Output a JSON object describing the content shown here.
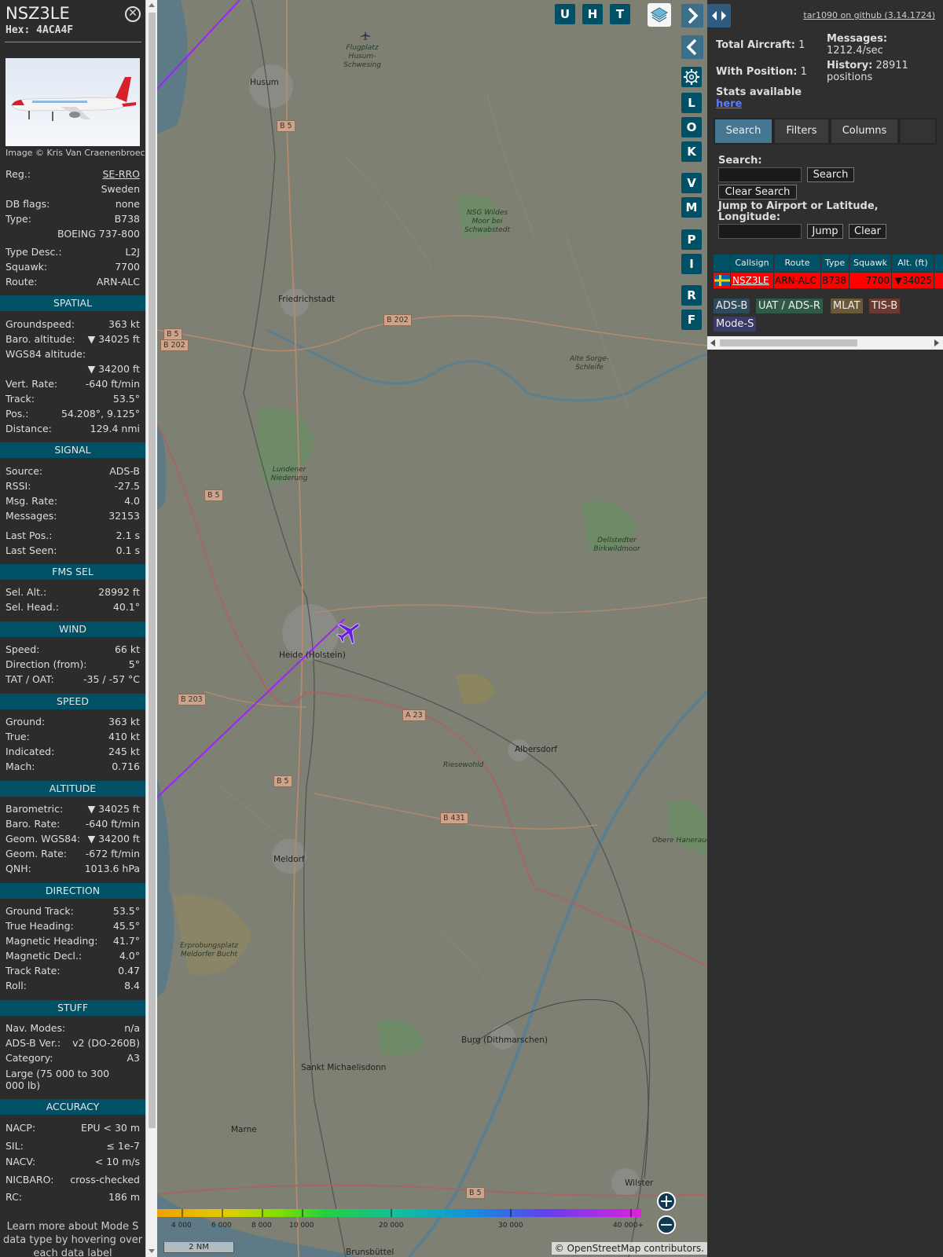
{
  "info": {
    "callsign": "NSZ3LE",
    "hex": "Hex: 4ACA4F",
    "image_credit": "Image © Kris Van Craenenbroeck",
    "reg_label": "Reg.:",
    "reg": "SE-RRO",
    "country": "Sweden",
    "dbflags_label": "DB flags:",
    "dbflags": "none",
    "type_label": "Type:",
    "type": "B738",
    "type_full": "BOEING 737-800",
    "typedesc_label": "Type Desc.:",
    "typedesc": "L2J",
    "squawk_label": "Squawk:",
    "squawk": "7700",
    "route_label": "Route:",
    "route": "ARN-ALC",
    "spatial": {
      "title": "SPATIAL",
      "groundspeed_label": "Groundspeed:",
      "groundspeed": "363 kt",
      "baro_label": "Baro. altitude:",
      "baro": "▼ 34025 ft",
      "wgs_label": "WGS84 altitude:",
      "wgs": "▼ 34200 ft",
      "vrate_label": "Vert. Rate:",
      "vrate": "-640 ft/min",
      "track_label": "Track:",
      "track": "53.5°",
      "pos_label": "Pos.:",
      "pos": "54.208°, 9.125°",
      "distance_label": "Distance:",
      "distance": "129.4 nmi"
    },
    "signal": {
      "title": "SIGNAL",
      "source_label": "Source:",
      "source": "ADS-B",
      "rssi_label": "RSSI:",
      "rssi": "-27.5",
      "msgrate_label": "Msg. Rate:",
      "msgrate": "4.0",
      "messages_label": "Messages:",
      "messages": "32153",
      "lastpos_label": "Last Pos.:",
      "lastpos": "2.1 s",
      "lastseen_label": "Last Seen:",
      "lastseen": "0.1 s"
    },
    "fms": {
      "title": "FMS SEL",
      "selalt_label": "Sel. Alt.:",
      "selalt": "28992 ft",
      "selhead_label": "Sel. Head.:",
      "selhead": "40.1°"
    },
    "wind": {
      "title": "WIND",
      "speed_label": "Speed:",
      "speed": "66 kt",
      "dir_label": "Direction (from):",
      "dir": "5°",
      "tat_label": "TAT / OAT:",
      "tat": "-35 / -57 °C"
    },
    "speed": {
      "title": "SPEED",
      "ground_label": "Ground:",
      "ground": "363 kt",
      "true_label": "True:",
      "true": "410 kt",
      "indicated_label": "Indicated:",
      "indicated": "245 kt",
      "mach_label": "Mach:",
      "mach": "0.716"
    },
    "altitude": {
      "title": "ALTITUDE",
      "baro_label": "Barometric:",
      "baro": "▼ 34025 ft",
      "barorate_label": "Baro. Rate:",
      "barorate": "-640 ft/min",
      "geom_label": "Geom. WGS84:",
      "geom": "▼ 34200 ft",
      "geomrate_label": "Geom. Rate:",
      "geomrate": "-672 ft/min",
      "qnh_label": "QNH:",
      "qnh": "1013.6 hPa"
    },
    "direction": {
      "title": "DIRECTION",
      "gtrack_label": "Ground Track:",
      "gtrack": "53.5°",
      "thead_label": "True Heading:",
      "thead": "45.5°",
      "mhead_label": "Magnetic Heading:",
      "mhead": "41.7°",
      "mdecl_label": "Magnetic Decl.:",
      "mdecl": "4.0°",
      "trate_label": "Track Rate:",
      "trate": "0.47",
      "roll_label": "Roll:",
      "roll": "8.4"
    },
    "stuff": {
      "title": "STUFF",
      "navmodes_label": "Nav. Modes:",
      "navmodes": "n/a",
      "adsbver_label": "ADS-B Ver.:",
      "adsbver": "v2 (DO-260B)",
      "category_label": "Category:",
      "category": "A3",
      "category_desc": "Large (75 000 to 300 000 lb)"
    },
    "accuracy": {
      "title": "ACCURACY",
      "nacp_label": "NACP:",
      "nacp": "EPU < 30 m",
      "sil_label": "SIL:",
      "sil": "≤ 1e-7",
      "nacv_label": "NACV:",
      "nacv": "< 10 m/s",
      "nicbaro_label": "NICBARO:",
      "nicbaro": "cross-checked",
      "rc_label": "RC:",
      "rc": "186 m"
    },
    "learn_more": "Learn more about Mode S data type by hovering over each data label"
  },
  "map": {
    "buttons": {
      "u": "U",
      "h": "H",
      "t": "T",
      "l": "L",
      "o": "O",
      "k": "K",
      "v": "V",
      "m": "M",
      "p": "P",
      "i": "I",
      "r": "R",
      "f": "F"
    },
    "places": {
      "husum": "Husum",
      "flugplatz": "Flugplatz Husum-Schwesing",
      "friedrichstadt": "Friedrichstadt",
      "heide": "Heide (Holstein)",
      "albersdorf": "Albersdorf",
      "meldorf": "Meldorf",
      "burg": "Burg (Dithmarschen)",
      "sanktm": "Sankt Michaelisdonn",
      "marne": "Marne",
      "wilster": "Wilster",
      "brunsbuttel": "Brunsbüttel",
      "nsg": "NSG Wildes Moor bei Schwabstedt",
      "alte": "Alte Sorge-Schleife",
      "lundener": "Lundener Niederung",
      "dellstedter": "Dellstedter Birkwildmoor",
      "riesewohld": "Riesewohld",
      "obere": "Obere Haneraue",
      "erprobung": "Erprobungsplatz Meldorfer Bucht"
    },
    "roads": {
      "b5": "B 5",
      "b202": "B 202",
      "b203": "B 203",
      "a23": "A 23",
      "b431": "B 431",
      "b202b": "B 202"
    },
    "altitude_legend": [
      "4 000",
      "6 000",
      "8 000",
      "10 000",
      "20 000",
      "30 000",
      "40 000+"
    ],
    "scale_label": "2 NM",
    "attribution_prefix": "© ",
    "attribution_link": "OpenStreetMap",
    "attribution_suffix": " contributors."
  },
  "sidebar": {
    "version_link": "tar1090 on github (3.14.1724)",
    "total_label": "Total Aircraft:",
    "total": "1",
    "withpos_label": "With Position:",
    "withpos": "1",
    "messages_label": "Messages:",
    "messages": "1212.4/sec",
    "history_label": "History:",
    "history": "28911 positions",
    "stats_label": "Stats available",
    "stats_link": "here",
    "tabs": {
      "search": "Search",
      "filters": "Filters",
      "columns": "Columns"
    },
    "search_label": "Search:",
    "search_button": "Search",
    "clear_search_button": "Clear Search",
    "jump_label": "Jump to Airport or Latitude, Longitude:",
    "jump_button": "Jump",
    "clear_button": "Clear",
    "table": {
      "headers": [
        "Callsign",
        "Route",
        "Type",
        "Squawk",
        "Alt. (ft)"
      ],
      "row": {
        "callsign": "NSZ3LE",
        "route": "ARN-ALC",
        "type": "B738",
        "squawk": "7700",
        "alt": "▼34025"
      }
    },
    "badges": {
      "adsb": "ADS-B",
      "uat": "UAT / ADS-R",
      "mlat": "MLAT",
      "tisb": "TIS-B",
      "modes": "Mode-S"
    }
  }
}
